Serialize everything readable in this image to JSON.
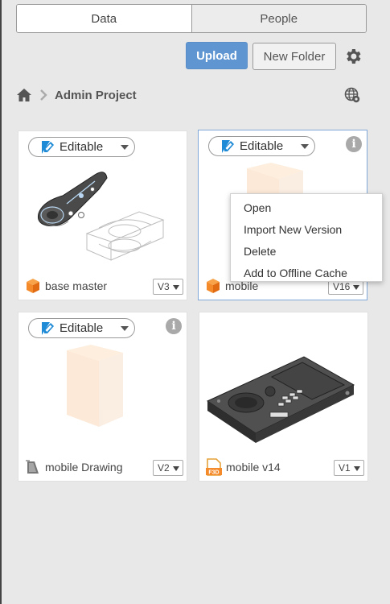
{
  "tabs": [
    {
      "label": "Data",
      "active": true
    },
    {
      "label": "People",
      "active": false
    }
  ],
  "toolbar": {
    "upload_label": "Upload",
    "new_folder_label": "New Folder"
  },
  "breadcrumb": {
    "project": "Admin Project"
  },
  "cards": [
    {
      "name": "base master",
      "version": "V3",
      "status": "Editable",
      "icon": "cube-icon"
    },
    {
      "name": "mobile",
      "version": "V16",
      "status": "Editable",
      "icon": "cube-icon",
      "info": "i"
    },
    {
      "name": "mobile Drawing",
      "version": "V2",
      "status": "Editable",
      "icon": "drawing-icon",
      "info": "i"
    },
    {
      "name": "mobile v14",
      "version": "V1",
      "icon": "f3d-file-icon",
      "icon_text": "F3D"
    }
  ],
  "context_menu": {
    "items": [
      "Open",
      "Import New Version",
      "Delete",
      "Add to Offline Cache"
    ]
  },
  "colors": {
    "accent": "#5f96d2",
    "cube": "#f58a2a",
    "pen": "#1f8ad6"
  }
}
